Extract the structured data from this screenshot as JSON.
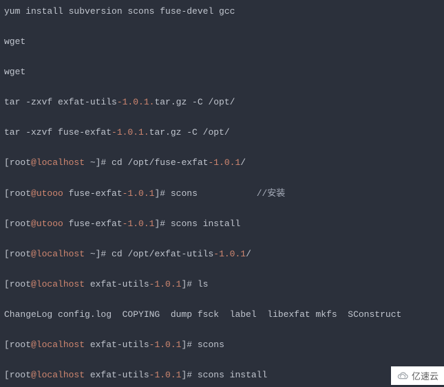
{
  "terminal": {
    "lines": [
      {
        "segments": [
          {
            "text": "yum install subversion scons fuse-devel gcc",
            "cls": "gray"
          }
        ]
      },
      {
        "segments": [
          {
            "text": "wget",
            "cls": "gray"
          }
        ]
      },
      {
        "segments": [
          {
            "text": "wget",
            "cls": "gray"
          }
        ]
      },
      {
        "segments": [
          {
            "text": "tar -zxvf exfat-utils",
            "cls": "gray"
          },
          {
            "text": "-1.0.1.",
            "cls": "orange"
          },
          {
            "text": "tar.gz -C /opt/",
            "cls": "gray"
          }
        ]
      },
      {
        "segments": [
          {
            "text": "tar -xzvf fuse-exfat",
            "cls": "gray"
          },
          {
            "text": "-1.0.1.",
            "cls": "orange"
          },
          {
            "text": "tar.gz -C /opt/",
            "cls": "gray"
          }
        ]
      },
      {
        "segments": [
          {
            "text": "[root",
            "cls": "gray"
          },
          {
            "text": "@localhost",
            "cls": "orange"
          },
          {
            "text": " ~]# cd /opt/fuse-exfat",
            "cls": "gray"
          },
          {
            "text": "-1.0.1",
            "cls": "orange"
          },
          {
            "text": "/",
            "cls": "gray"
          }
        ]
      },
      {
        "segments": [
          {
            "text": "[root",
            "cls": "gray"
          },
          {
            "text": "@utooo",
            "cls": "orange"
          },
          {
            "text": " fuse-exfat",
            "cls": "gray"
          },
          {
            "text": "-1.0.1",
            "cls": "orange"
          },
          {
            "text": "]# scons           ",
            "cls": "gray"
          },
          {
            "text": "//安装",
            "cls": "comment"
          }
        ]
      },
      {
        "segments": [
          {
            "text": "[root",
            "cls": "gray"
          },
          {
            "text": "@utooo",
            "cls": "orange"
          },
          {
            "text": " fuse-exfat",
            "cls": "gray"
          },
          {
            "text": "-1.0.1",
            "cls": "orange"
          },
          {
            "text": "]# scons install",
            "cls": "gray"
          }
        ]
      },
      {
        "segments": [
          {
            "text": "[root",
            "cls": "gray"
          },
          {
            "text": "@localhost",
            "cls": "orange"
          },
          {
            "text": " ~]# cd /opt/exfat-utils",
            "cls": "gray"
          },
          {
            "text": "-1.0.1",
            "cls": "orange"
          },
          {
            "text": "/",
            "cls": "gray"
          }
        ]
      },
      {
        "segments": [
          {
            "text": "[root",
            "cls": "gray"
          },
          {
            "text": "@localhost",
            "cls": "orange"
          },
          {
            "text": " exfat-utils",
            "cls": "gray"
          },
          {
            "text": "-1.0.1",
            "cls": "orange"
          },
          {
            "text": "]# ls",
            "cls": "gray"
          }
        ]
      },
      {
        "segments": [
          {
            "text": "ChangeLog config.log  COPYING  dump fsck  label  libexfat mkfs  SConstruct",
            "cls": "gray"
          }
        ]
      },
      {
        "segments": [
          {
            "text": "[root",
            "cls": "gray"
          },
          {
            "text": "@localhost",
            "cls": "orange"
          },
          {
            "text": " exfat-utils",
            "cls": "gray"
          },
          {
            "text": "-1.0.1",
            "cls": "orange"
          },
          {
            "text": "]# scons",
            "cls": "gray"
          }
        ]
      },
      {
        "segments": [
          {
            "text": "[root",
            "cls": "gray"
          },
          {
            "text": "@localhost",
            "cls": "orange"
          },
          {
            "text": " exfat-utils",
            "cls": "gray"
          },
          {
            "text": "-1.0.1",
            "cls": "orange"
          },
          {
            "text": "]# scons install",
            "cls": "gray"
          }
        ]
      }
    ]
  },
  "watermark": {
    "text": "亿速云"
  },
  "colors": {
    "background": "#2b303b",
    "text": "#c0c5ce",
    "accent": "#d08770",
    "comment": "#a7adba"
  }
}
